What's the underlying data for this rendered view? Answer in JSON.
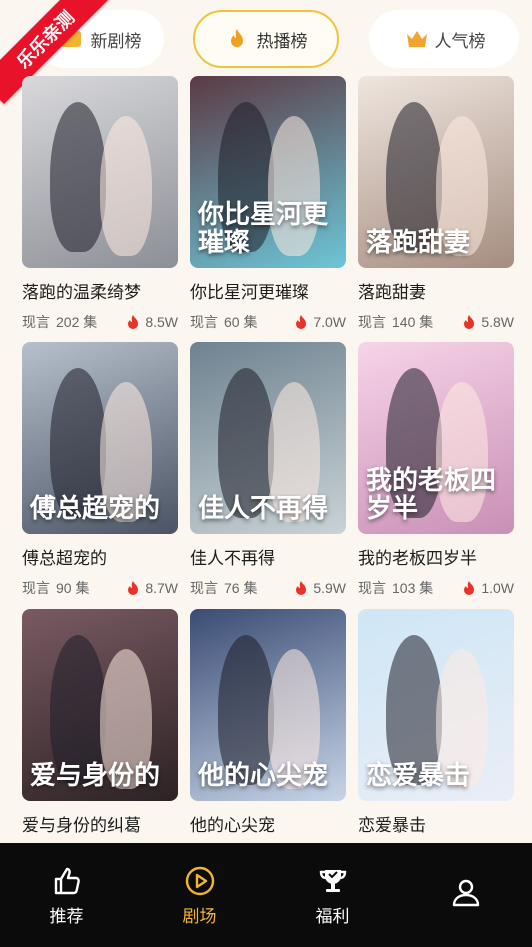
{
  "ribbon": "乐乐亲测",
  "tabs": [
    {
      "label": "新剧榜"
    },
    {
      "label": "热播榜"
    },
    {
      "label": "人气榜"
    }
  ],
  "cards": [
    {
      "name": "落跑的温柔绮梦",
      "genre": "现言",
      "episodes": "202 集",
      "heat": "8.5W",
      "art": "",
      "bg": [
        "#d9d9dc",
        "#8c8f96"
      ]
    },
    {
      "name": "你比星河更璀璨",
      "genre": "现言",
      "episodes": "60 集",
      "heat": "7.0W",
      "art": "你比星河更璀璨",
      "bg": [
        "#5b3a44",
        "#6cc6d8"
      ]
    },
    {
      "name": "落跑甜妻",
      "genre": "现言",
      "episodes": "140 集",
      "heat": "5.8W",
      "art": "落跑甜妻",
      "bg": [
        "#efe6df",
        "#a58d80"
      ]
    },
    {
      "name": "傅总超宠的",
      "genre": "现言",
      "episodes": "90 集",
      "heat": "8.7W",
      "art": "傅总超宠的",
      "bg": [
        "#b7c0cc",
        "#4a5464"
      ]
    },
    {
      "name": "佳人不再得",
      "genre": "现言",
      "episodes": "76 集",
      "heat": "5.9W",
      "art": "佳人不再得",
      "bg": [
        "#6e8290",
        "#c9d3d6"
      ]
    },
    {
      "name": "我的老板四岁半",
      "genre": "现言",
      "episodes": "103 集",
      "heat": "1.0W",
      "art": "我的老板四岁半",
      "bg": [
        "#f7d4e8",
        "#c98fb6"
      ]
    },
    {
      "name": "爱与身份的纠葛",
      "genre": "",
      "episodes": "",
      "heat": "",
      "art": "爱与身份的",
      "bg": [
        "#7a5a63",
        "#2c2224"
      ]
    },
    {
      "name": "他的心尖宠",
      "genre": "",
      "episodes": "",
      "heat": "",
      "art": "他的心尖宠",
      "bg": [
        "#3a4c74",
        "#c8d5e8"
      ]
    },
    {
      "name": "恋爱暴击",
      "genre": "",
      "episodes": "",
      "heat": "",
      "art": "恋爱暴击",
      "bg": [
        "#cfe6f5",
        "#e9eef7"
      ]
    }
  ],
  "nav": [
    {
      "label": "推荐",
      "icon": "thumbs-up-icon"
    },
    {
      "label": "剧场",
      "icon": "play-circle-icon"
    },
    {
      "label": "福利",
      "icon": "trophy-icon"
    },
    {
      "label": "",
      "icon": "user-icon"
    }
  ],
  "colors": {
    "accent": "#f2b531",
    "ribbon": "#e8132a",
    "fire": "#e8322a"
  }
}
